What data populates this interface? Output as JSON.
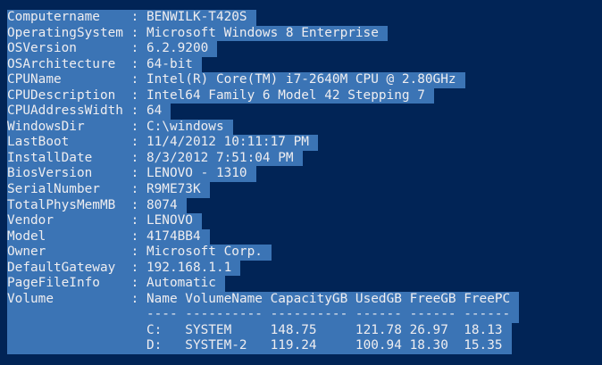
{
  "colors": {
    "background": "#012456",
    "selection": "#3b74b5",
    "text": "#eeedf0"
  },
  "separator": " : ",
  "properties": [
    {
      "key": "Computername",
      "value": "BENWILK-T420S"
    },
    {
      "key": "OperatingSystem",
      "value": "Microsoft Windows 8 Enterprise"
    },
    {
      "key": "OSVersion",
      "value": "6.2.9200"
    },
    {
      "key": "OSArchitecture",
      "value": "64-bit"
    },
    {
      "key": "CPUName",
      "value": "Intel(R) Core(TM) i7-2640M CPU @ 2.80GHz"
    },
    {
      "key": "CPUDescription",
      "value": "Intel64 Family 6 Model 42 Stepping 7"
    },
    {
      "key": "CPUAddressWidth",
      "value": "64"
    },
    {
      "key": "WindowsDir",
      "value": "C:\\windows"
    },
    {
      "key": "LastBoot",
      "value": "11/4/2012 10:11:17 PM"
    },
    {
      "key": "InstallDate",
      "value": "8/3/2012 7:51:04 PM"
    },
    {
      "key": "BiosVersion",
      "value": "LENOVO - 1310"
    },
    {
      "key": "SerialNumber",
      "value": "R9ME73K"
    },
    {
      "key": "TotalPhysMemMB",
      "value": "8074"
    },
    {
      "key": "Vendor",
      "value": "LENOVO"
    },
    {
      "key": "Model",
      "value": "4174BB4"
    },
    {
      "key": "Owner",
      "value": "Microsoft Corp."
    },
    {
      "key": "DefaultGateway",
      "value": "192.168.1.1"
    },
    {
      "key": "PageFileInfo",
      "value": "Automatic"
    }
  ],
  "volume": {
    "key": "Volume",
    "headers": [
      "Name",
      "VolumeName",
      "CapacityGB",
      "UsedGB",
      "FreeGB",
      "FreePC"
    ],
    "rows": [
      [
        "C:",
        "SYSTEM",
        "148.75",
        "121.78",
        "26.97",
        "18.13"
      ],
      [
        "D:",
        "SYSTEM-2",
        "119.24",
        "100.94",
        "18.30",
        "15.35"
      ]
    ]
  }
}
